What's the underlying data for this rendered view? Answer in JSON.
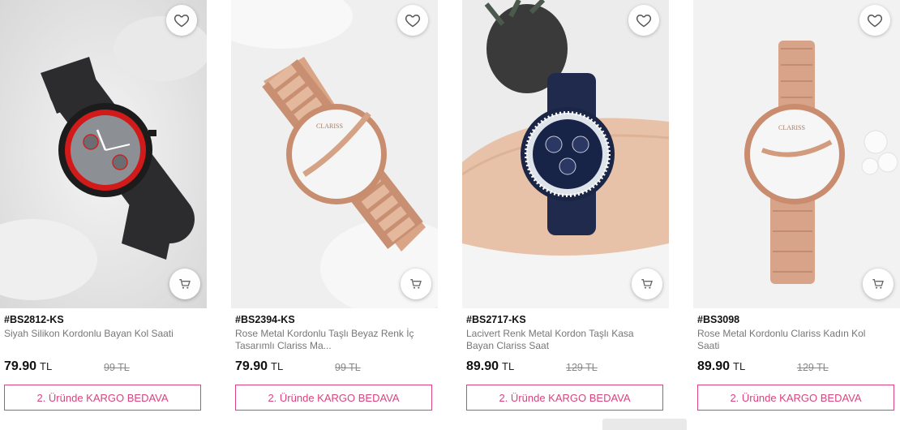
{
  "products": [
    {
      "code": "#BS2812-KS",
      "name": "Siyah Silikon Kordonlu Bayan Kol Saati",
      "price": "79.90",
      "currency": "TL",
      "old_price": "99 TL",
      "promo": "2. Üründe KARGO BEDAVA",
      "image": "watch-black-silicone-red-bezel"
    },
    {
      "code": "#BS2394-KS",
      "name": "Rose Metal Kordonlu Taşlı Beyaz Renk İç Tasarımlı Clariss Ma...",
      "price": "79.90",
      "currency": "TL",
      "old_price": "99 TL",
      "promo": "2. Üründe KARGO BEDAVA",
      "image": "watch-rose-gold-white-dial"
    },
    {
      "code": "#BS2717-KS",
      "name": "Lacivert Renk Metal Kordon Taşlı Kasa Bayan Clariss Saat",
      "price": "89.90",
      "currency": "TL",
      "old_price": "129 TL",
      "promo": "2. Üründe KARGO BEDAVA",
      "image": "watch-navy-stones-on-wrist"
    },
    {
      "code": "#BS3098",
      "name": "Rose Metal Kordonlu Clariss Kadın Kol Saati",
      "price": "89.90",
      "currency": "TL",
      "old_price": "129 TL",
      "promo": "2. Üründe KARGO BEDAVA",
      "image": "watch-rose-gold-slim"
    }
  ],
  "icons": {
    "favorite": "heart-outline-icon",
    "cart": "shopping-cart-icon"
  },
  "colors": {
    "accent": "#d9437f"
  }
}
